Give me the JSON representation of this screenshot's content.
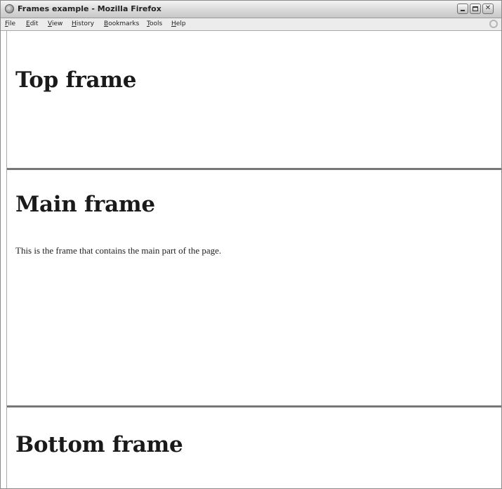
{
  "window": {
    "title": "Frames example - Mozilla Firefox",
    "icon": "firefox-icon",
    "controls": [
      "minimize-icon",
      "maximize-icon",
      "close-icon"
    ]
  },
  "menubar": {
    "items": [
      {
        "label": "File"
      },
      {
        "label": "Edit"
      },
      {
        "label": "View"
      },
      {
        "label": "History"
      },
      {
        "label": "Bookmarks"
      },
      {
        "label": "Tools"
      },
      {
        "label": "Help"
      }
    ]
  },
  "frames": {
    "top": {
      "heading": "Top frame"
    },
    "main": {
      "heading": "Main frame",
      "text": "This is the frame that contains the main part of the page."
    },
    "bottom": {
      "heading": "Bottom frame"
    }
  }
}
